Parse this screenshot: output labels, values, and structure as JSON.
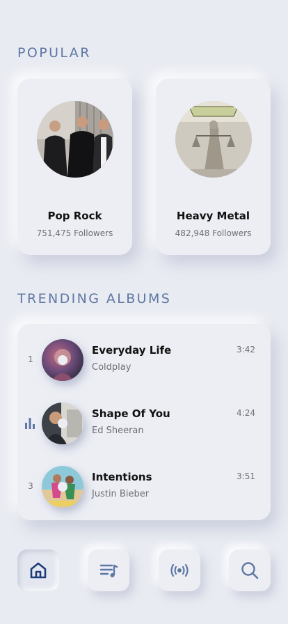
{
  "sections": {
    "popular_title": "POPULAR",
    "trending_title": "TRENDING ALBUMS"
  },
  "genres": [
    {
      "name": "Pop Rock",
      "followers": "751,475 Followers"
    },
    {
      "name": "Heavy Metal",
      "followers": "482,948 Followers"
    }
  ],
  "albums": [
    {
      "rank": "1",
      "title": "Everyday Life",
      "artist": "Coldplay",
      "duration": "3:42",
      "playing": false
    },
    {
      "rank": "",
      "title": "Shape Of You",
      "artist": "Ed Sheeran",
      "duration": "4:24",
      "playing": true
    },
    {
      "rank": "3",
      "title": "Intentions",
      "artist": "Justin Bieber",
      "duration": "3:51",
      "playing": false
    }
  ],
  "nav": [
    {
      "icon": "home-icon",
      "active": true
    },
    {
      "icon": "playlist-icon",
      "active": false
    },
    {
      "icon": "radio-icon",
      "active": false
    },
    {
      "icon": "search-icon",
      "active": false
    }
  ],
  "colors": {
    "background": "#e9ebf2",
    "section_title": "#5f77a4",
    "icon": "#5f77a4",
    "active_icon": "#1d3d7a"
  }
}
